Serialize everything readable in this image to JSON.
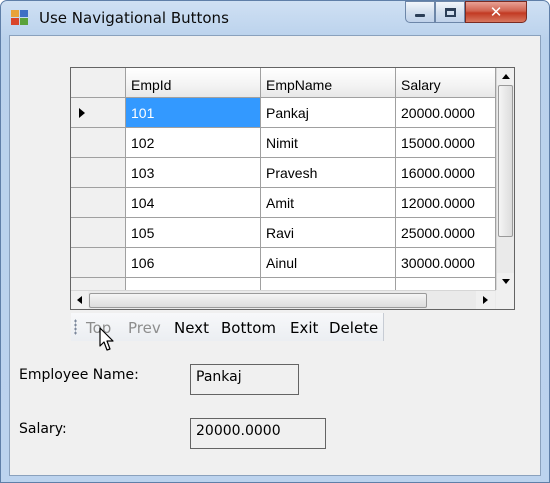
{
  "window": {
    "title": "Use Navigational Buttons",
    "close_glyph": "✕"
  },
  "grid": {
    "columns": [
      "EmpId",
      "EmpName",
      "Salary"
    ],
    "rows": [
      {
        "id": "101",
        "name": "Pankaj",
        "salary": "20000.0000"
      },
      {
        "id": "102",
        "name": "Nimit",
        "salary": "15000.0000"
      },
      {
        "id": "103",
        "name": "Pravesh",
        "salary": "16000.0000"
      },
      {
        "id": "104",
        "name": "Amit",
        "salary": "12000.0000"
      },
      {
        "id": "105",
        "name": "Ravi",
        "salary": "25000.0000"
      },
      {
        "id": "106",
        "name": "Ainul",
        "salary": "30000.0000"
      }
    ]
  },
  "toolbar": {
    "top": "Top",
    "prev": "Prev",
    "next": "Next",
    "bottom": "Bottom",
    "exit": "Exit",
    "delete": "Delete"
  },
  "form": {
    "name_label": "Employee Name:",
    "name_value": "Pankaj",
    "salary_label": "Salary:",
    "salary_value": "20000.0000"
  },
  "colors": {
    "selection": "#3399ff",
    "close_button": "#c23a23"
  }
}
